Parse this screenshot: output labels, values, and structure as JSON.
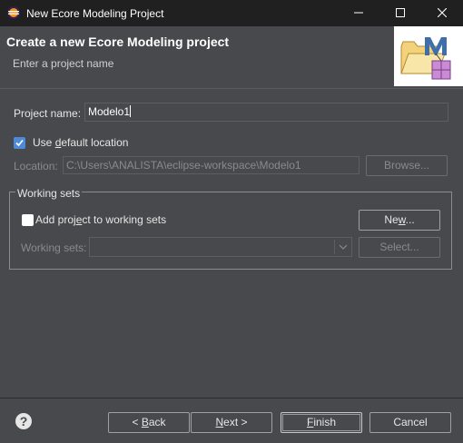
{
  "window": {
    "title": "New Ecore Modeling Project",
    "minimize": "minimize",
    "maximize": "maximize",
    "close": "close"
  },
  "header": {
    "title": "Create a new Ecore Modeling project",
    "subtitle": "Enter a project name",
    "image_icon": "ecore-wizard-icon"
  },
  "form": {
    "project_name_label": "Project name:",
    "project_name_value": "Modelo1",
    "use_default_location_pre": "Use ",
    "use_default_location_mnemonic": "d",
    "use_default_location_post": "efault location",
    "use_default_location_checked": true,
    "location_label": "Location:",
    "location_value": "C:\\Users\\ANALISTA\\eclipse-workspace\\Modelo1",
    "browse_label": "Browse..."
  },
  "working_sets": {
    "group_title": "Working sets",
    "add_label_pre": "Add proj",
    "add_label_mnemonic": "e",
    "add_label_post": "ct to working sets",
    "add_checked": false,
    "new_label_pre": "Ne",
    "new_label_mnemonic": "w",
    "new_label_post": "...",
    "working_sets_label": "Working sets:",
    "working_sets_value": "",
    "select_label": "Select..."
  },
  "footer": {
    "help_icon": "help-icon",
    "back_pre": "< ",
    "back_mnemonic": "B",
    "back_post": "ack",
    "next_pre": "",
    "next_mnemonic": "N",
    "next_post": "ext >",
    "finish_pre": "",
    "finish_mnemonic": "F",
    "finish_post": "inish",
    "cancel_label": "Cancel"
  },
  "colors": {
    "accent": "#4f8ad8",
    "background": "#48494c",
    "titlebar": "#202020"
  }
}
